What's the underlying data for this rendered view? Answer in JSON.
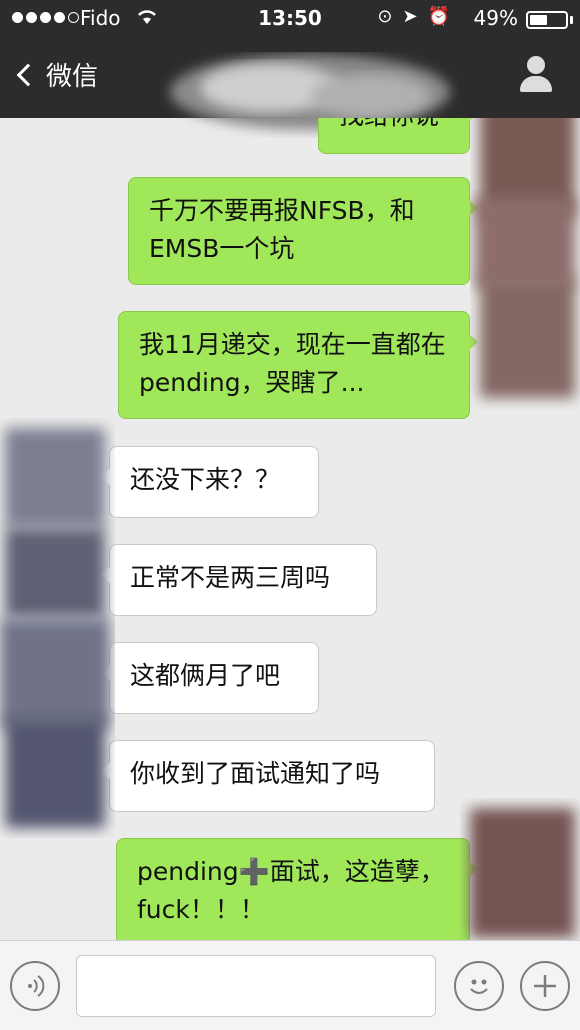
{
  "status_bar": {
    "carrier": "Fido",
    "time": "13:50",
    "battery_percent": "49%",
    "battery_level": 0.49
  },
  "nav": {
    "back_label": "微信",
    "profile_icon": "person-icon"
  },
  "messages": [
    {
      "direction": "outgoing",
      "text": "找给你说"
    },
    {
      "direction": "outgoing",
      "text": "千万不要再报NFSB，和EMSB一个坑"
    },
    {
      "direction": "outgoing",
      "text": "我11月递交，现在一直都在pending，哭瞎了..."
    },
    {
      "direction": "incoming",
      "text": "还没下来？？"
    },
    {
      "direction": "incoming",
      "text": "正常不是两三周吗"
    },
    {
      "direction": "incoming",
      "text": "这都俩月了吧"
    },
    {
      "direction": "incoming",
      "text": "你收到了面试通知了吗"
    },
    {
      "direction": "outgoing",
      "text": "pending➕面试，这造孽，fuck！！！"
    }
  ],
  "input_bar": {
    "voice_icon": "voice-icon",
    "emoji_icon": "emoji-icon",
    "plus_icon": "plus-icon",
    "text_value": ""
  }
}
